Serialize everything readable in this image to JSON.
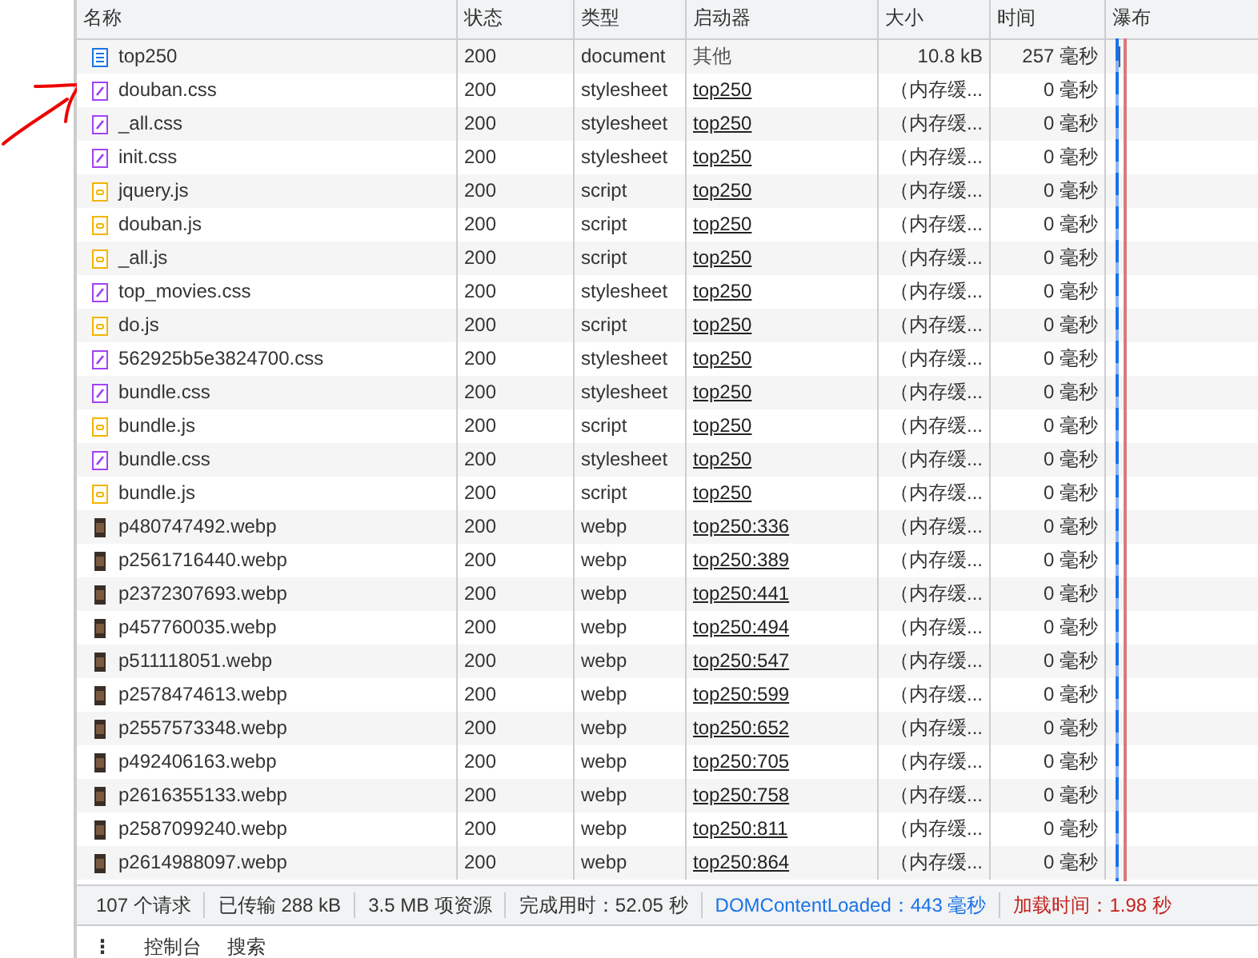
{
  "table": {
    "columns": [
      "名称",
      "状态",
      "类型",
      "启动器",
      "大小",
      "时间",
      "瀑布"
    ],
    "rows": [
      {
        "kind": "document",
        "name": "top250",
        "status": "200",
        "type": "document",
        "initiator": "其他",
        "initiator_link": false,
        "size": "10.8 kB",
        "time": "257 毫秒"
      },
      {
        "kind": "stylesheet",
        "name": "douban.css",
        "status": "200",
        "type": "stylesheet",
        "initiator": "top250",
        "initiator_link": true,
        "size": "（内存缓...",
        "time": "0 毫秒"
      },
      {
        "kind": "stylesheet",
        "name": "_all.css",
        "status": "200",
        "type": "stylesheet",
        "initiator": "top250",
        "initiator_link": true,
        "size": "（内存缓...",
        "time": "0 毫秒"
      },
      {
        "kind": "stylesheet",
        "name": "init.css",
        "status": "200",
        "type": "stylesheet",
        "initiator": "top250",
        "initiator_link": true,
        "size": "（内存缓...",
        "time": "0 毫秒"
      },
      {
        "kind": "script",
        "name": "jquery.js",
        "status": "200",
        "type": "script",
        "initiator": "top250",
        "initiator_link": true,
        "size": "（内存缓...",
        "time": "0 毫秒"
      },
      {
        "kind": "script",
        "name": "douban.js",
        "status": "200",
        "type": "script",
        "initiator": "top250",
        "initiator_link": true,
        "size": "（内存缓...",
        "time": "0 毫秒"
      },
      {
        "kind": "script",
        "name": "_all.js",
        "status": "200",
        "type": "script",
        "initiator": "top250",
        "initiator_link": true,
        "size": "（内存缓...",
        "time": "0 毫秒"
      },
      {
        "kind": "stylesheet",
        "name": "top_movies.css",
        "status": "200",
        "type": "stylesheet",
        "initiator": "top250",
        "initiator_link": true,
        "size": "（内存缓...",
        "time": "0 毫秒"
      },
      {
        "kind": "script",
        "name": "do.js",
        "status": "200",
        "type": "script",
        "initiator": "top250",
        "initiator_link": true,
        "size": "（内存缓...",
        "time": "0 毫秒"
      },
      {
        "kind": "stylesheet",
        "name": "562925b5e3824700.css",
        "status": "200",
        "type": "stylesheet",
        "initiator": "top250",
        "initiator_link": true,
        "size": "（内存缓...",
        "time": "0 毫秒"
      },
      {
        "kind": "stylesheet",
        "name": "bundle.css",
        "status": "200",
        "type": "stylesheet",
        "initiator": "top250",
        "initiator_link": true,
        "size": "（内存缓...",
        "time": "0 毫秒"
      },
      {
        "kind": "script",
        "name": "bundle.js",
        "status": "200",
        "type": "script",
        "initiator": "top250",
        "initiator_link": true,
        "size": "（内存缓...",
        "time": "0 毫秒"
      },
      {
        "kind": "stylesheet",
        "name": "bundle.css",
        "status": "200",
        "type": "stylesheet",
        "initiator": "top250",
        "initiator_link": true,
        "size": "（内存缓...",
        "time": "0 毫秒"
      },
      {
        "kind": "script",
        "name": "bundle.js",
        "status": "200",
        "type": "script",
        "initiator": "top250",
        "initiator_link": true,
        "size": "（内存缓...",
        "time": "0 毫秒"
      },
      {
        "kind": "image",
        "name": "p480747492.webp",
        "status": "200",
        "type": "webp",
        "initiator": "top250:336",
        "initiator_link": true,
        "size": "（内存缓...",
        "time": "0 毫秒"
      },
      {
        "kind": "image",
        "name": "p2561716440.webp",
        "status": "200",
        "type": "webp",
        "initiator": "top250:389",
        "initiator_link": true,
        "size": "（内存缓...",
        "time": "0 毫秒"
      },
      {
        "kind": "image",
        "name": "p2372307693.webp",
        "status": "200",
        "type": "webp",
        "initiator": "top250:441",
        "initiator_link": true,
        "size": "（内存缓...",
        "time": "0 毫秒"
      },
      {
        "kind": "image",
        "name": "p457760035.webp",
        "status": "200",
        "type": "webp",
        "initiator": "top250:494",
        "initiator_link": true,
        "size": "（内存缓...",
        "time": "0 毫秒"
      },
      {
        "kind": "image",
        "name": "p511118051.webp",
        "status": "200",
        "type": "webp",
        "initiator": "top250:547",
        "initiator_link": true,
        "size": "（内存缓...",
        "time": "0 毫秒"
      },
      {
        "kind": "image",
        "name": "p2578474613.webp",
        "status": "200",
        "type": "webp",
        "initiator": "top250:599",
        "initiator_link": true,
        "size": "（内存缓...",
        "time": "0 毫秒"
      },
      {
        "kind": "image",
        "name": "p2557573348.webp",
        "status": "200",
        "type": "webp",
        "initiator": "top250:652",
        "initiator_link": true,
        "size": "（内存缓...",
        "time": "0 毫秒"
      },
      {
        "kind": "image",
        "name": "p492406163.webp",
        "status": "200",
        "type": "webp",
        "initiator": "top250:705",
        "initiator_link": true,
        "size": "（内存缓...",
        "time": "0 毫秒"
      },
      {
        "kind": "image",
        "name": "p2616355133.webp",
        "status": "200",
        "type": "webp",
        "initiator": "top250:758",
        "initiator_link": true,
        "size": "（内存缓...",
        "time": "0 毫秒"
      },
      {
        "kind": "image",
        "name": "p2587099240.webp",
        "status": "200",
        "type": "webp",
        "initiator": "top250:811",
        "initiator_link": true,
        "size": "（内存缓...",
        "time": "0 毫秒"
      },
      {
        "kind": "image",
        "name": "p2614988097.webp",
        "status": "200",
        "type": "webp",
        "initiator": "top250:864",
        "initiator_link": true,
        "size": "（内存缓...",
        "time": "0 毫秒"
      }
    ]
  },
  "status_bar": [
    {
      "kind": "plain",
      "text": "107 个请求"
    },
    {
      "kind": "plain",
      "text": "已传输 288 kB"
    },
    {
      "kind": "plain",
      "text": "3.5 MB 项资源"
    },
    {
      "kind": "plain",
      "text": "完成用时：52.05 秒"
    },
    {
      "kind": "dom",
      "text": "DOMContentLoaded：443 毫秒"
    },
    {
      "kind": "load",
      "text": "加载时间：1.98 秒"
    }
  ],
  "drawer": {
    "menu": "⋮",
    "tabs": [
      "控制台",
      "搜索"
    ]
  }
}
